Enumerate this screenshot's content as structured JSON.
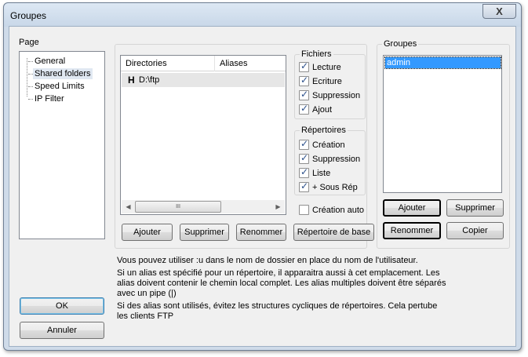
{
  "window": {
    "title": "Groupes",
    "close_symbol": "X"
  },
  "page_panel": {
    "label": "Page",
    "items": [
      {
        "label": "General",
        "selected": false
      },
      {
        "label": "Shared folders",
        "selected": true
      },
      {
        "label": "Speed Limits",
        "selected": false
      },
      {
        "label": "IP Filter",
        "selected": false
      }
    ]
  },
  "directories_list": {
    "columns": [
      "Directories",
      "Aliases"
    ],
    "rows": [
      {
        "marker": "H",
        "directory": "D:\\ftp",
        "aliases": ""
      }
    ],
    "scroll_thumb_glyph": "III"
  },
  "fichiers": {
    "title": "Fichiers",
    "options": [
      {
        "label": "Lecture",
        "checked": true
      },
      {
        "label": "Ecriture",
        "checked": true
      },
      {
        "label": "Suppression",
        "checked": true
      },
      {
        "label": "Ajout",
        "checked": true
      }
    ]
  },
  "repertoires": {
    "title": "Répertoires",
    "options": [
      {
        "label": "Création",
        "checked": true
      },
      {
        "label": "Suppression",
        "checked": true
      },
      {
        "label": "Liste",
        "checked": true
      },
      {
        "label": "+ Sous Rép",
        "checked": true
      }
    ]
  },
  "creation_auto": {
    "label": "Création auto",
    "checked": false
  },
  "dir_buttons": {
    "ajouter": "Ajouter",
    "supprimer": "Supprimer",
    "renommer": "Renommer",
    "repertoire_base": "Répertoire de base"
  },
  "groupes": {
    "title": "Groupes",
    "items": [
      "admin"
    ],
    "buttons": {
      "ajouter": "Ajouter",
      "supprimer": "Supprimer",
      "renommer": "Renommer",
      "copier": "Copier"
    }
  },
  "info_text": [
    "Vous pouvez utiliser :u dans le nom de dossier en place du nom de l'utilisateur.",
    "Si un alias est spécifié pour un répertoire, il apparaitra aussi à cet emplacement. Les alias doivent contenir le chemin local complet. Les alias multiples doivent être séparés avec un pipe (|)",
    "Si des alias sont utilisés, évitez les structures cycliques de répertoires. Cela pertube les clients FTP"
  ],
  "dialog_buttons": {
    "ok": "OK",
    "annuler": "Annuler"
  },
  "colors": {
    "selection": "#3399ff",
    "frame": "#cfdbe9",
    "dialog_bg": "#f0f0f0"
  }
}
